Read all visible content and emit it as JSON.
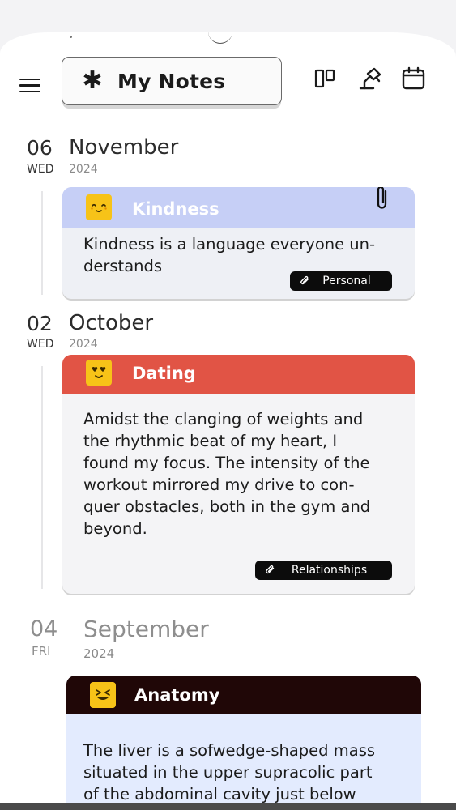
{
  "header": {
    "title": "My Notes",
    "title_glyph": "✱"
  },
  "colors": {
    "kindness_header": "#c6cff6",
    "kindness_body": "#eef0f5",
    "dating_header": "#e15445",
    "dating_body": "#f4f4f6",
    "anatomy_header": "#200707",
    "anatomy_body": "#e3ebfe",
    "emoji_bg": "#f7c318",
    "tag_bg": "#0c0c0c"
  },
  "entries": [
    {
      "day": "06",
      "weekday": "WED",
      "month": "November",
      "year": "2024",
      "note": {
        "title": "Kindness",
        "emoji_icon": "smiling-face-icon",
        "text": "Kindness is a language everyone un-\nderstands",
        "tag": "Personal",
        "pinned": true
      }
    },
    {
      "day": "02",
      "weekday": "WED",
      "month": "October",
      "year": "2024",
      "note": {
        "title": "Dating",
        "emoji_icon": "heart-eyes-face-icon",
        "text": "Amidst the clanging of weights and\nthe rhythmic beat of my heart, I\nfound my focus. The intensity of the\nworkout mirrored my drive to con-\nquer obstacles, both in the gym and\nbeyond.",
        "tag": "Relationships"
      }
    },
    {
      "day": "04",
      "weekday": "FRI",
      "month": "September",
      "year": "2024",
      "note": {
        "title": "Anatomy",
        "emoji_icon": "grinning-squint-face-icon",
        "text": "The liver is a sofwedge-shaped mass\nsituated in the upper supracolic part\nof the abdominal cavity just below"
      }
    }
  ]
}
